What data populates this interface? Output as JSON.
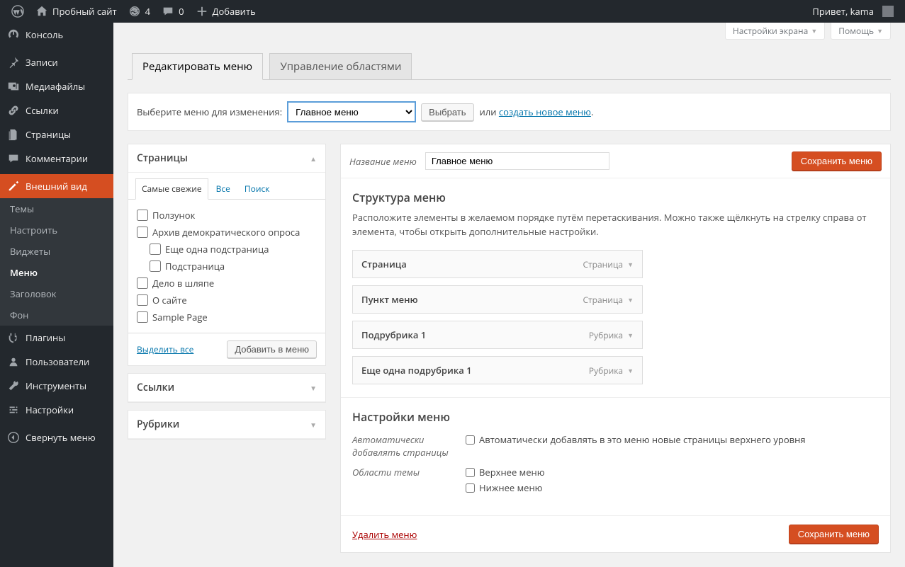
{
  "adminbar": {
    "site_name": "Пробный сайт",
    "updates_count": "4",
    "comments_count": "0",
    "add_new": "Добавить",
    "greeting": "Привет, kama"
  },
  "sidebar": {
    "dashboard": "Консоль",
    "posts": "Записи",
    "media": "Медиафайлы",
    "links": "Ссылки",
    "pages": "Страницы",
    "comments": "Комментарии",
    "appearance": "Внешний вид",
    "appearance_sub": {
      "themes": "Темы",
      "customize": "Настроить",
      "widgets": "Виджеты",
      "menus": "Меню",
      "header": "Заголовок",
      "background": "Фон"
    },
    "plugins": "Плагины",
    "users": "Пользователи",
    "tools": "Инструменты",
    "settings": "Настройки",
    "collapse": "Свернуть меню"
  },
  "screen_meta": {
    "screen_options": "Настройки экрана",
    "help": "Помощь"
  },
  "tabs": {
    "edit": "Редактировать меню",
    "locations": "Управление областями"
  },
  "selectbar": {
    "label": "Выберите меню для изменения:",
    "selected": "Главное меню",
    "select_btn": "Выбрать",
    "or": "или",
    "create_link": "создать новое меню",
    "period": "."
  },
  "metaboxes": {
    "pages": {
      "title": "Страницы",
      "tabs": {
        "recent": "Самые свежие",
        "all": "Все",
        "search": "Поиск"
      },
      "items": [
        {
          "label": "Ползунок",
          "indent": 0
        },
        {
          "label": "Архив демократического опроса",
          "indent": 0
        },
        {
          "label": "Еще одна подстраница",
          "indent": 1
        },
        {
          "label": "Подстраница",
          "indent": 1
        },
        {
          "label": "Дело в шляпе",
          "indent": 0
        },
        {
          "label": "О сайте",
          "indent": 0
        },
        {
          "label": "Sample Page",
          "indent": 0
        }
      ],
      "select_all": "Выделить все",
      "add_btn": "Добавить в меню"
    },
    "links": {
      "title": "Ссылки"
    },
    "categories": {
      "title": "Рубрики"
    }
  },
  "menu_edit": {
    "name_label": "Название меню",
    "name_value": "Главное меню",
    "save_btn": "Сохранить меню",
    "structure_heading": "Структура меню",
    "structure_desc": "Расположите элементы в желаемом порядке путём перетаскивания. Можно также щёлкнуть на стрелку справа от элемента, чтобы открыть дополнительные настройки.",
    "items": [
      {
        "title": "Страница",
        "type": "Страница"
      },
      {
        "title": "Пункт меню",
        "type": "Страница"
      },
      {
        "title": "Подрубрика 1",
        "type": "Рубрика"
      },
      {
        "title": "Еще одна подрубрика 1",
        "type": "Рубрика"
      }
    ],
    "settings_heading": "Настройки меню",
    "auto_add_label": "Автоматически добавлять страницы",
    "auto_add_checkbox": "Автоматически добавлять в это меню новые страницы верхнего уровня",
    "locations_label": "Области темы",
    "locations": [
      {
        "label": "Верхнее меню"
      },
      {
        "label": "Нижнее меню"
      }
    ],
    "delete": "Удалить меню"
  }
}
